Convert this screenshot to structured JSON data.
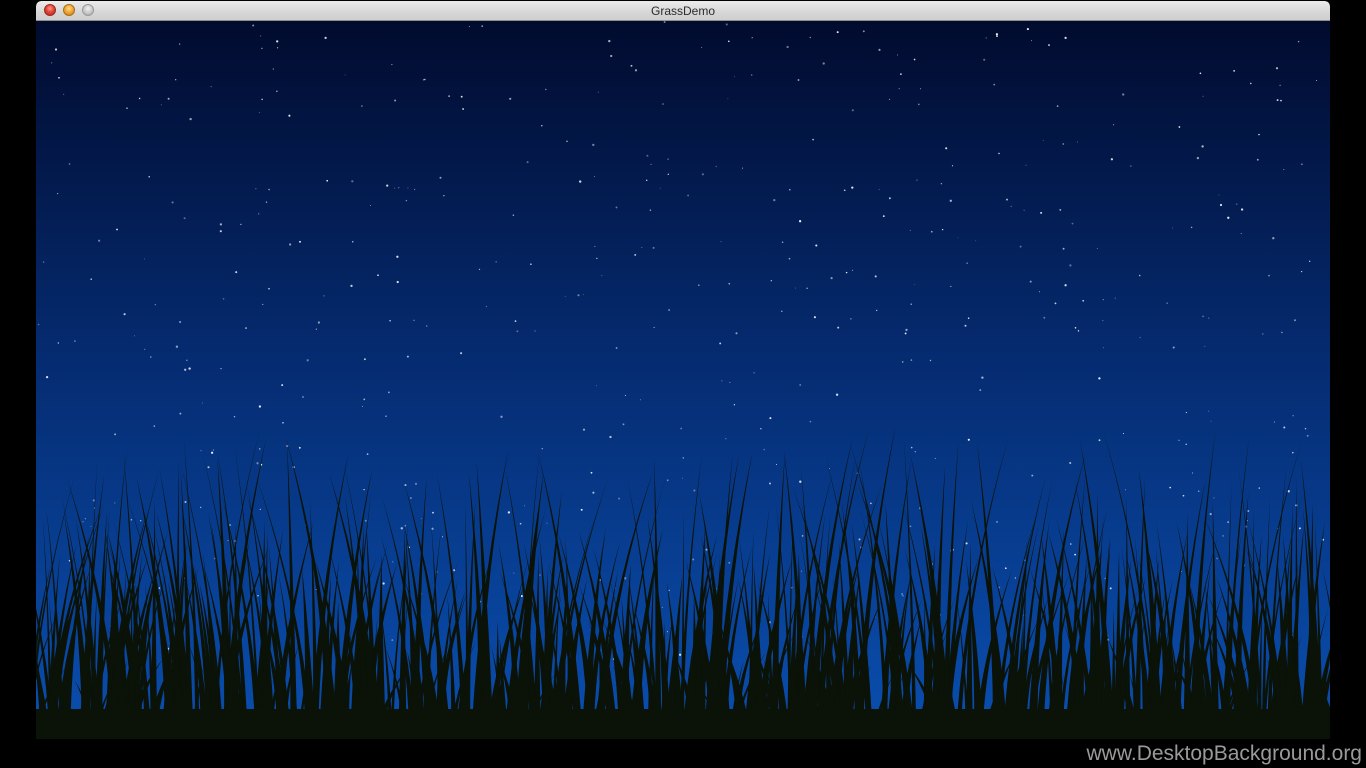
{
  "window": {
    "title": "GrassDemo",
    "buttons": {
      "close": "close-icon",
      "minimize": "minimize-icon",
      "zoom": "zoom-icon"
    }
  },
  "scene": {
    "sky_top_color": "#010b2e",
    "sky_mid_color": "#052a6e",
    "sky_bottom_color": "#0a4fb0",
    "grass_color": "#0b1208"
  },
  "watermark": "www.DesktopBackground.org"
}
